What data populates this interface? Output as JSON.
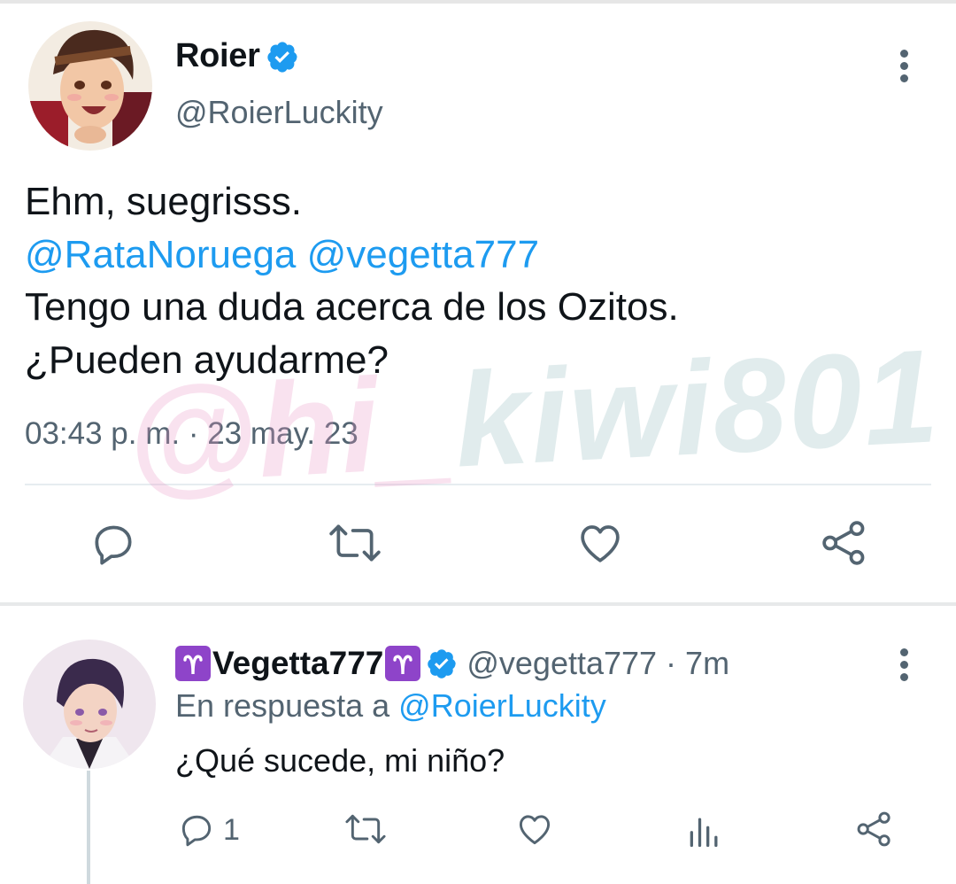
{
  "main_tweet": {
    "display_name": "Roier",
    "handle": "@RoierLuckity",
    "text_line1": "Ehm, suegrisss.",
    "mention1": "@RataNoruega",
    "mention2": "@vegetta777",
    "text_line3": "Tengo una duda acerca de los Ozitos.",
    "text_line4": "¿Pueden ayudarme?",
    "timestamp": "03:43 p. m. · 23 may. 23"
  },
  "reply": {
    "display_name": "Vegetta777",
    "handle": "@vegetta777 · 7m",
    "reply_prefix": "En respuesta a",
    "reply_mention": "@RoierLuckity",
    "text": "¿Qué sucede, mi niño?",
    "reply_count": "1"
  },
  "watermark": {
    "text_a": "@hi_",
    "text_b": "kiwi801"
  },
  "colors": {
    "accent": "#1d9bf0",
    "secondary": "#536471",
    "aries_purple": "#8e44c9"
  },
  "icons": [
    "verified-badge-icon",
    "more-options-icon",
    "reply-icon",
    "retweet-icon",
    "like-icon",
    "share-icon",
    "views-icon",
    "aries-emoji-icon"
  ]
}
